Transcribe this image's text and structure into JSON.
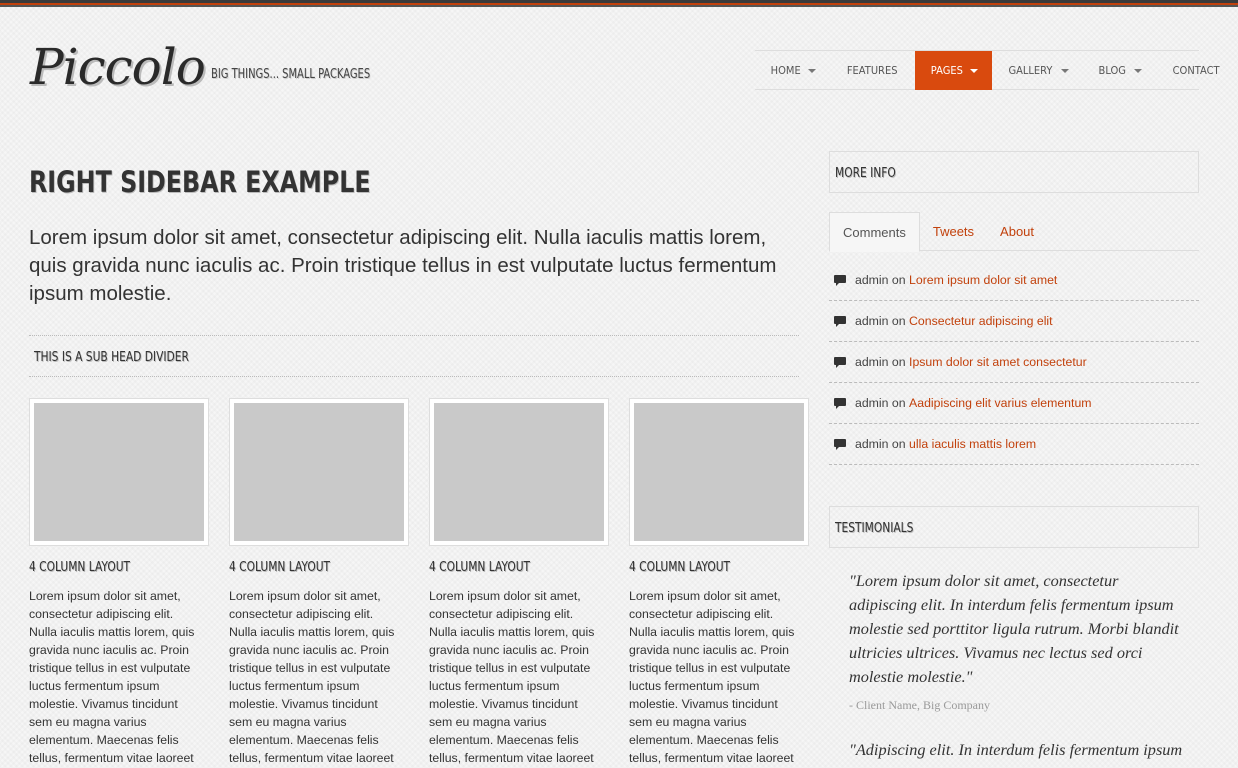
{
  "brand": {
    "logo": "Piccolo",
    "tagline": "BIG THINGS... SMALL PACKAGES"
  },
  "nav": {
    "items": [
      {
        "label": "HOME",
        "dropdown": true,
        "active": false
      },
      {
        "label": "FEATURES",
        "dropdown": false,
        "active": false
      },
      {
        "label": "PAGES",
        "dropdown": true,
        "active": true
      },
      {
        "label": "GALLERY",
        "dropdown": true,
        "active": false
      },
      {
        "label": "BLOG",
        "dropdown": true,
        "active": false
      },
      {
        "label": "CONTACT",
        "dropdown": false,
        "active": false
      }
    ]
  },
  "main": {
    "title": "RIGHT SIDEBAR EXAMPLE",
    "lead": "Lorem ipsum dolor sit amet, consectetur adipiscing elit. Nulla iaculis mattis lorem, quis gravida nunc iaculis ac. Proin tristique tellus in est vulputate luctus fermentum ipsum molestie.",
    "subhead": "THIS IS A SUB HEAD DIVIDER",
    "columns": [
      {
        "title": "4 COLUMN LAYOUT",
        "text": "Lorem ipsum dolor sit amet, consectetur adipiscing elit. Nulla iaculis mattis lorem, quis gravida nunc iaculis ac. Proin tristique tellus in est vulputate luctus fermentum ipsum molestie. Vivamus tincidunt sem eu magna varius elementum. Maecenas felis tellus, fermentum vitae laoreet"
      },
      {
        "title": "4 COLUMN LAYOUT",
        "text": "Lorem ipsum dolor sit amet, consectetur adipiscing elit. Nulla iaculis mattis lorem, quis gravida nunc iaculis ac. Proin tristique tellus in est vulputate luctus fermentum ipsum molestie. Vivamus tincidunt sem eu magna varius elementum. Maecenas felis tellus, fermentum vitae laoreet"
      },
      {
        "title": "4 COLUMN LAYOUT",
        "text": "Lorem ipsum dolor sit amet, consectetur adipiscing elit. Nulla iaculis mattis lorem, quis gravida nunc iaculis ac. Proin tristique tellus in est vulputate luctus fermentum ipsum molestie. Vivamus tincidunt sem eu magna varius elementum. Maecenas felis tellus, fermentum vitae laoreet"
      },
      {
        "title": "4 COLUMN LAYOUT",
        "text": "Lorem ipsum dolor sit amet, consectetur adipiscing elit. Nulla iaculis mattis lorem, quis gravida nunc iaculis ac. Proin tristique tellus in est vulputate luctus fermentum ipsum molestie. Vivamus tincidunt sem eu magna varius elementum. Maecenas felis tellus, fermentum vitae laoreet"
      }
    ]
  },
  "sidebar": {
    "more_info": "MORE INFO",
    "tabs": [
      {
        "label": "Comments",
        "active": true
      },
      {
        "label": "Tweets",
        "active": false
      },
      {
        "label": "About",
        "active": false
      }
    ],
    "comments": [
      {
        "author": "admin",
        "on": "on",
        "link": "Lorem ipsum dolor sit amet"
      },
      {
        "author": "admin",
        "on": "on",
        "link": "Consectetur adipiscing elit"
      },
      {
        "author": "admin",
        "on": "on",
        "link": "Ipsum dolor sit amet consectetur"
      },
      {
        "author": "admin",
        "on": "on",
        "link": "Aadipiscing elit varius elementum"
      },
      {
        "author": "admin",
        "on": "on",
        "link": "ulla iaculis mattis lorem"
      }
    ],
    "testimonials_title": "TESTIMONIALS",
    "testimonials": [
      {
        "quote": "\"Lorem ipsum dolor sit amet, consectetur adipiscing elit. In interdum felis fermentum ipsum molestie sed porttitor ligula rutrum. Morbi blandit ultricies ultrices. Vivamus nec lectus sed orci molestie molestie.\"",
        "cite": "- Client Name, Big Company"
      },
      {
        "quote": "\"Adipiscing elit. In interdum felis fermentum ipsum"
      }
    ]
  },
  "colors": {
    "accent": "#d94a0e",
    "link": "#c2410c",
    "text": "#333333"
  }
}
